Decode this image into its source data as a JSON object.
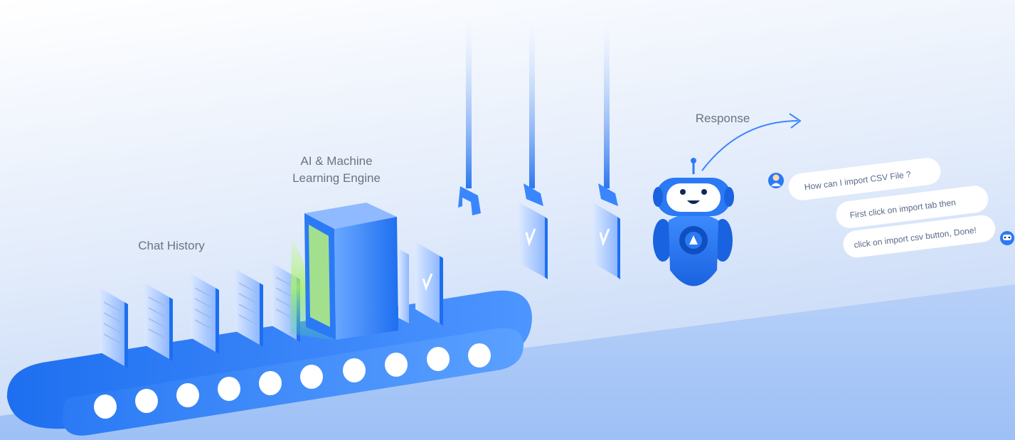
{
  "labels": {
    "chat_history": "Chat History",
    "engine_line1": "AI & Machine",
    "engine_line2": "Learning Engine",
    "response": "Response"
  },
  "chat": {
    "user_question": "How can I import CSV File ?",
    "bot_reply_line1": "First click on import tab then",
    "bot_reply_line2": "click on import csv button, Done!"
  },
  "colors": {
    "background_top": "#ffffff",
    "background_bottom": "#a9c8f7",
    "accent_blue": "#1e6ff0",
    "accent_light": "#5aa0ff",
    "engine_glow": "#a8f26a",
    "label_gray": "#6a7480"
  }
}
